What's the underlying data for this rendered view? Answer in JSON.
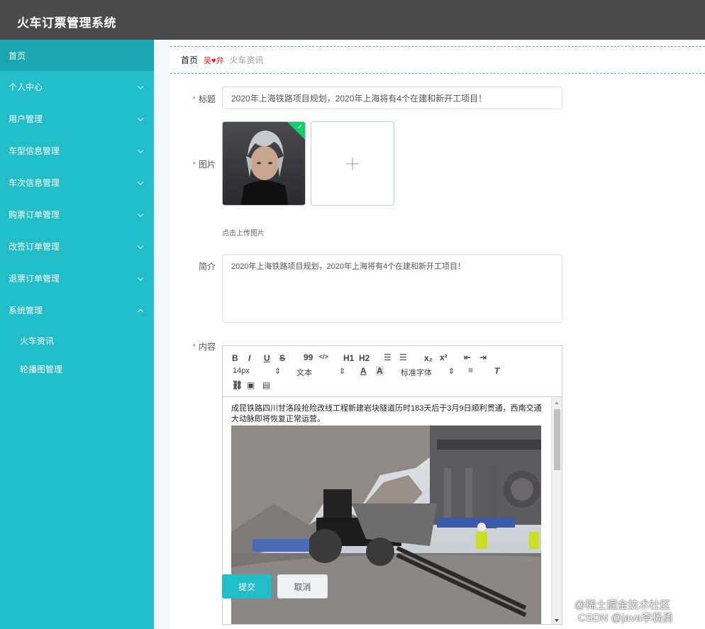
{
  "app": {
    "title": "火车订票管理系统"
  },
  "sidebar": {
    "items": [
      {
        "label": "首页",
        "expandable": false
      },
      {
        "label": "个人中心",
        "expandable": true
      },
      {
        "label": "用户管理",
        "expandable": true
      },
      {
        "label": "车型信息管理",
        "expandable": true
      },
      {
        "label": "车次信息管理",
        "expandable": true
      },
      {
        "label": "购票订单管理",
        "expandable": true
      },
      {
        "label": "改签订单管理",
        "expandable": true
      },
      {
        "label": "退票订单管理",
        "expandable": true
      },
      {
        "label": "系统管理",
        "expandable": true,
        "expanded": true
      }
    ],
    "sub_items": [
      {
        "label": "火车资讯"
      },
      {
        "label": "轮播图管理"
      }
    ]
  },
  "breadcrumb": {
    "home": "首页",
    "separator": "吴",
    "separator_tail": "弁",
    "current": "火车资讯"
  },
  "form": {
    "title_label": "标题",
    "title_value": "2020年上海铁路项目规划，2020年上海将有4个在建和新开工项目！",
    "image_label": "图片",
    "upload_hint": "点击上传图片",
    "intro_label": "简介",
    "intro_value": "2020年上海铁路项目规划，2020年上海将有4个在建和新开工项目！",
    "content_label": "内容",
    "required_mark": "*"
  },
  "editor": {
    "toolbar": {
      "bold": "B",
      "italic": "I",
      "underline": "U",
      "strike": "S",
      "quote": "99",
      "code": "</>",
      "h1": "H1",
      "h2": "H2",
      "subscript": "x₂",
      "superscript": "x²",
      "font_size": "14px",
      "text_type": "文本",
      "font_family": "标准字体"
    },
    "body_text": "成昆铁路四川甘洛段抢险改线工程新建岩块隧道历时183天后于3月9日顺利贯通，西南交通大动脉即将恢复正常运营。"
  },
  "buttons": {
    "submit": "提交",
    "cancel": "取消"
  },
  "watermark": {
    "line1": "@稀土掘金技术社区",
    "line2": "CSDN @java李杨勇"
  },
  "colors": {
    "sidebar": "#21bdc8",
    "topbar": "#4a4a4a",
    "accent": "#21bdc8",
    "required": "#f56c6c"
  }
}
